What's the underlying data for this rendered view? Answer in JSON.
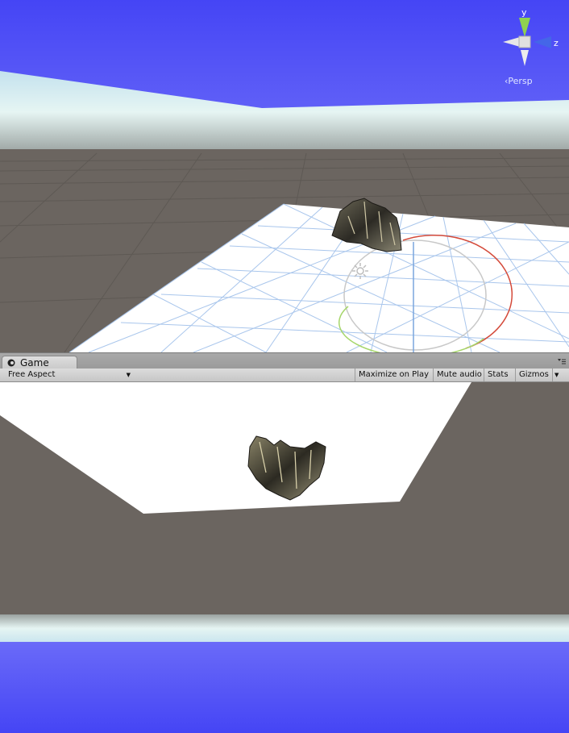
{
  "scene": {
    "gizmo": {
      "y_label": "y",
      "z_label": "z",
      "projection_label": "‹Persp"
    },
    "colors": {
      "sky": "#4f4ff7",
      "horizon": "#dbeef0",
      "ground": "#6b6560",
      "plane": "#ffffff",
      "grid_lines": "#a9c6ec"
    },
    "icons": [
      "light-icon",
      "rock-model",
      "rotate-gizmo"
    ]
  },
  "game_tab": {
    "label": "Game",
    "icon": "camera-icon"
  },
  "toolbar": {
    "aspect_label": "Free Aspect",
    "maximize_label": "Maximize on Play",
    "mute_label": "Mute audio",
    "stats_label": "Stats",
    "gizmos_label": "Gizmos"
  },
  "game": {
    "colors": {
      "ground": "#6b6560",
      "plane": "#ffffff",
      "horizon": "#dbeef0",
      "sky": "#4f4ff7"
    }
  }
}
